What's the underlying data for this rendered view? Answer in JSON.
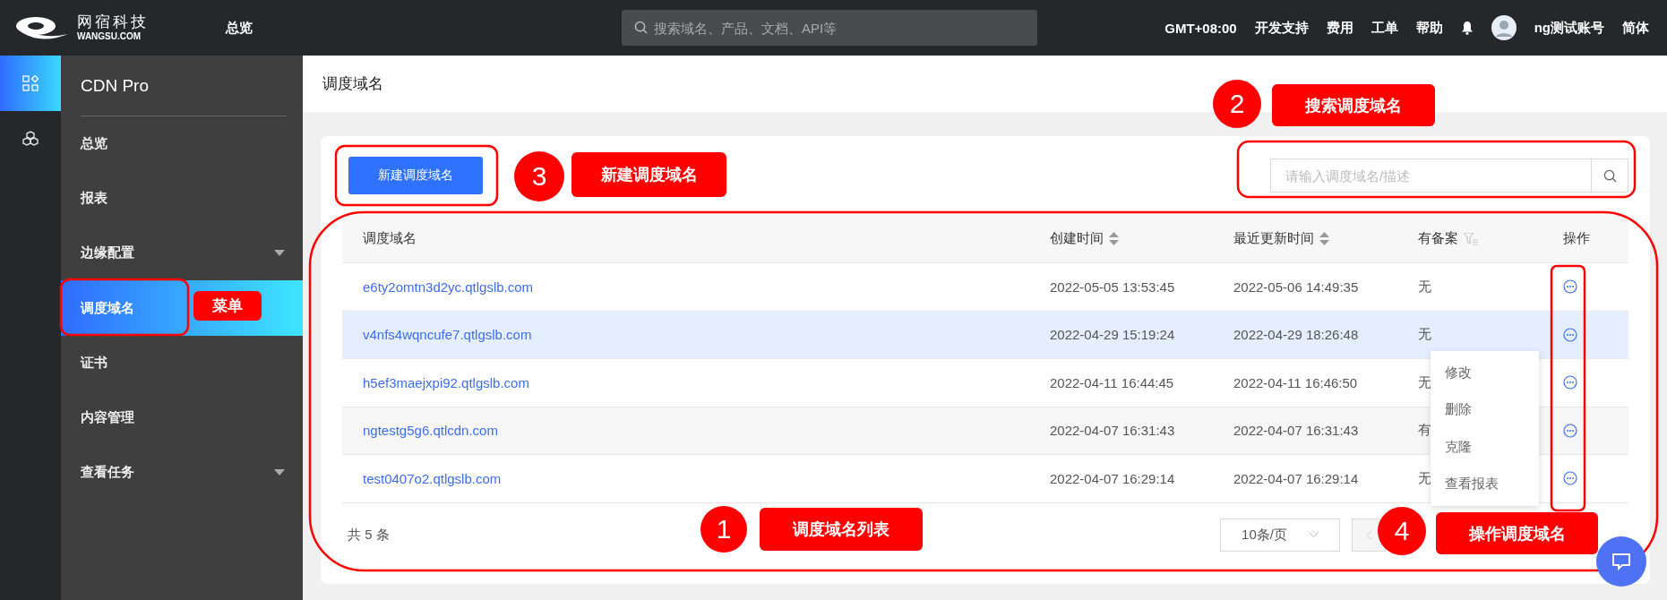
{
  "topbar": {
    "logo_cn": "网宿科技",
    "logo_en": "WANGSU.COM",
    "nav": "总览",
    "search": {
      "placeholder": "搜索域名、产品、文档、API等"
    },
    "links": [
      "GMT+08:00",
      "开发支持",
      "费用",
      "工单",
      "帮助"
    ],
    "account": "ng测试账号",
    "language": "简体"
  },
  "rail": [
    {
      "kind": "grid",
      "selected": true
    },
    {
      "kind": "cubes",
      "selected": false
    }
  ],
  "sidebar": {
    "title": "CDN Pro",
    "items": [
      {
        "label": "总览",
        "selected": false
      },
      {
        "label": "报表",
        "selected": false
      },
      {
        "label": "边缘配置",
        "selected": false,
        "expanded": false
      },
      {
        "label": "调度域名",
        "selected": true
      },
      {
        "label": "证书",
        "selected": false
      },
      {
        "label": "内容管理",
        "selected": false
      },
      {
        "label": "查看任务",
        "selected": false,
        "expanded": false
      }
    ]
  },
  "page": {
    "title": "调度域名",
    "new_button": "新建调度域名",
    "search": {
      "placeholder": "请输入调度域名/描述"
    }
  },
  "table": {
    "columns": [
      {
        "label": "调度域名",
        "kind": "plain"
      },
      {
        "label": "创建时间",
        "kind": "sort"
      },
      {
        "label": "最近更新时间",
        "kind": "sort"
      },
      {
        "label": "有备案",
        "kind": "filter"
      },
      {
        "label": "操作",
        "kind": "plain"
      }
    ],
    "rows": [
      {
        "domain": "e6ty2omtn3d2yc.qtlgslb.com",
        "created": "2022-05-05 13:53:45",
        "updated": "2022-05-06 14:49:35",
        "filed": "无",
        "hovered": false
      },
      {
        "domain": "v4nfs4wqncufe7.qtlgslb.com",
        "created": "2022-04-29 15:19:24",
        "updated": "2022-04-29 18:26:48",
        "filed": "无",
        "hovered": true
      },
      {
        "domain": "h5ef3maejxpi92.qtlgslb.com",
        "created": "2022-04-11 16:44:45",
        "updated": "2022-04-11 16:46:50",
        "filed": "无",
        "hovered": false
      },
      {
        "domain": "ngtestg5g6.qtlcdn.com",
        "created": "2022-04-07 16:31:43",
        "updated": "2022-04-07 16:31:43",
        "filed": "有",
        "hovered": false
      },
      {
        "domain": "test0407o2.qtlgslb.com",
        "created": "2022-04-07 16:29:14",
        "updated": "2022-04-07 16:29:14",
        "filed": "无",
        "hovered": false
      }
    ]
  },
  "action_menu": [
    "修改",
    "删除",
    "克隆",
    "查看报表"
  ],
  "pagination": {
    "total": "共 5 条",
    "page_size": "10条/页",
    "prev_disabled": true
  },
  "annotations": [
    {
      "kind": "callout",
      "number": "1",
      "label": "调度域名列表"
    },
    {
      "kind": "callout",
      "number": "2",
      "label": "搜索调度域名"
    },
    {
      "kind": "callout",
      "number": "3",
      "label": "新建调度域名"
    },
    {
      "kind": "callout",
      "number": "4",
      "label": "操作调度域名"
    },
    {
      "kind": "tag",
      "label": "菜单"
    }
  ]
}
